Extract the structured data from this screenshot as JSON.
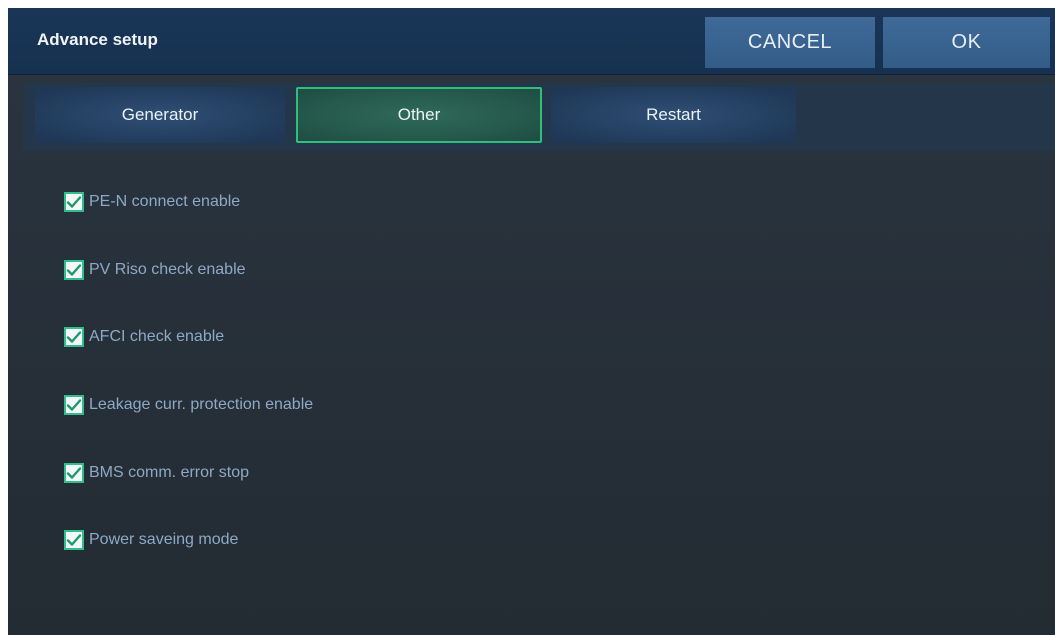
{
  "header": {
    "title": "Advance setup",
    "cancel_label": "CANCEL",
    "ok_label": "OK"
  },
  "tabs": [
    {
      "label": "Generator",
      "active": false
    },
    {
      "label": "Other",
      "active": true
    },
    {
      "label": "Restart",
      "active": false
    }
  ],
  "options": [
    {
      "label": "PE-N connect enable",
      "checked": true,
      "icon": "checkmark-icon"
    },
    {
      "label": "PV Riso check enable",
      "checked": true,
      "icon": "checkmark-icon"
    },
    {
      "label": "AFCI check enable",
      "checked": true,
      "icon": "checkmark-icon"
    },
    {
      "label": "Leakage curr. protection enable",
      "checked": true,
      "icon": "checkmark-icon"
    },
    {
      "label": "BMS comm. error stop",
      "checked": true,
      "icon": "checkmark-icon"
    },
    {
      "label": "Power saveing mode",
      "checked": true,
      "icon": "checkmark-icon"
    }
  ],
  "colors": {
    "header_bg": "#163150",
    "button_bg": "#3a6491",
    "active_tab_border": "#2fbf7a",
    "checkbox_border": "#2fbf8a",
    "option_text": "#8ea9c6",
    "panel_bg": "#262f38"
  }
}
